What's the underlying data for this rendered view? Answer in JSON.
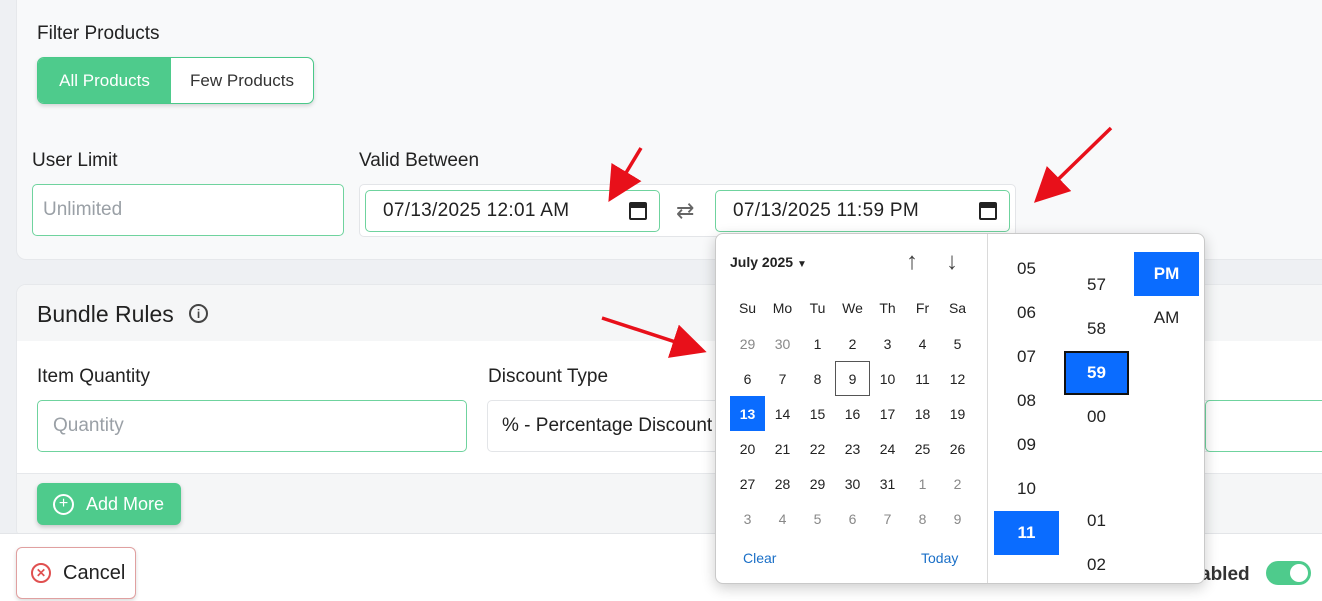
{
  "filter": {
    "label": "Filter Products",
    "options": [
      "All Products",
      "Few Products"
    ],
    "selected": "All Products"
  },
  "user_limit": {
    "label": "User Limit",
    "placeholder": "Unlimited"
  },
  "valid_between": {
    "label": "Valid Between",
    "start": "07/13/2025 12:01 AM",
    "end": "07/13/2025 11:59 PM"
  },
  "bundle_rules": {
    "title": "Bundle Rules",
    "item_quantity": {
      "label": "Item Quantity",
      "placeholder": "Quantity"
    },
    "discount_type": {
      "label": "Discount Type",
      "value": "% - Percentage Discount"
    },
    "add_more": "Add More"
  },
  "footer": {
    "cancel": "Cancel",
    "enabled_label": "abled"
  },
  "picker": {
    "month_label": "July 2025",
    "weekdays": [
      "Su",
      "Mo",
      "Tu",
      "We",
      "Th",
      "Fr",
      "Sa"
    ],
    "weeks": [
      [
        {
          "d": "29",
          "m": true
        },
        {
          "d": "30",
          "m": true
        },
        {
          "d": "1"
        },
        {
          "d": "2"
        },
        {
          "d": "3"
        },
        {
          "d": "4"
        },
        {
          "d": "5"
        }
      ],
      [
        {
          "d": "6"
        },
        {
          "d": "7"
        },
        {
          "d": "8"
        },
        {
          "d": "9",
          "today": true
        },
        {
          "d": "10"
        },
        {
          "d": "11"
        },
        {
          "d": "12"
        }
      ],
      [
        {
          "d": "13",
          "sel": true
        },
        {
          "d": "14"
        },
        {
          "d": "15"
        },
        {
          "d": "16"
        },
        {
          "d": "17"
        },
        {
          "d": "18"
        },
        {
          "d": "19"
        }
      ],
      [
        {
          "d": "20"
        },
        {
          "d": "21"
        },
        {
          "d": "22"
        },
        {
          "d": "23"
        },
        {
          "d": "24"
        },
        {
          "d": "25"
        },
        {
          "d": "26"
        }
      ],
      [
        {
          "d": "27"
        },
        {
          "d": "28"
        },
        {
          "d": "29"
        },
        {
          "d": "30"
        },
        {
          "d": "31"
        },
        {
          "d": "1",
          "m": true
        },
        {
          "d": "2",
          "m": true
        }
      ],
      [
        {
          "d": "3",
          "m": true
        },
        {
          "d": "4",
          "m": true
        },
        {
          "d": "5",
          "m": true
        },
        {
          "d": "6",
          "m": true
        },
        {
          "d": "7",
          "m": true
        },
        {
          "d": "8",
          "m": true
        },
        {
          "d": "9",
          "m": true
        }
      ]
    ],
    "clear": "Clear",
    "today": "Today",
    "hours": [
      "05",
      "06",
      "07",
      "08",
      "09",
      "10",
      "11"
    ],
    "selected_hour": "11",
    "minutes_top": [
      "57",
      "58",
      "59",
      "00"
    ],
    "minutes_bottom": [
      "01",
      "02"
    ],
    "selected_minute": "59",
    "ampm": [
      "PM",
      "AM"
    ],
    "selected_ampm": "PM"
  },
  "annotation_color": "#e8101a"
}
